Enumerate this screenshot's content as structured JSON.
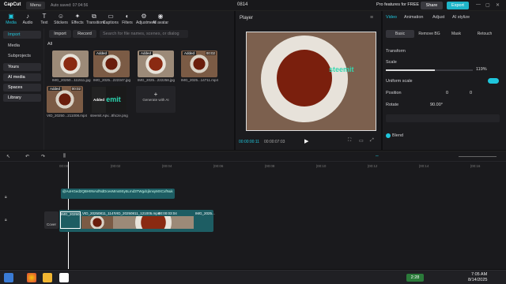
{
  "app": {
    "name": "CapCut",
    "menu": "Menu",
    "autosave": "Auto saved: 07:04:56",
    "project": "0814",
    "pro": "Pro features for FREE",
    "share": "Share",
    "export": "Export"
  },
  "tools": [
    {
      "label": "Media",
      "icon": "▣"
    },
    {
      "label": "Audio",
      "icon": "♪"
    },
    {
      "label": "Text",
      "icon": "T"
    },
    {
      "label": "Stickers",
      "icon": "☺"
    },
    {
      "label": "Effects",
      "icon": "✦"
    },
    {
      "label": "Transitions",
      "icon": "⧉"
    },
    {
      "label": "Captions",
      "icon": "▭"
    },
    {
      "label": "Filters",
      "icon": "◐"
    },
    {
      "label": "Adjustment",
      "icon": "⚙"
    },
    {
      "label": "AI avatar",
      "icon": "◉"
    }
  ],
  "sidenav": {
    "import": "Import",
    "items": [
      "Media",
      "Subprojects",
      "Yours",
      "AI media",
      "Spaces",
      "Library"
    ]
  },
  "media": {
    "import_btn": "Import",
    "record_btn": "Record",
    "search_placeholder": "Search for file names, scenes, or dialog",
    "all": "All",
    "added": "Added",
    "items": [
      {
        "name": "IMG_20250...111511.jpg",
        "tag": "",
        "dur": ""
      },
      {
        "name": "IMG_2025...222347.jpg",
        "tag": "Added",
        "dur": ""
      },
      {
        "name": "IMG_2025...222258.jpg",
        "tag": "Added",
        "dur": ""
      },
      {
        "name": "IMG_2025...14711.mp4",
        "tag": "Added",
        "dur": "00:02"
      },
      {
        "name": "VID_20250...211008.mp4",
        "tag": "Added",
        "dur": "00:02"
      },
      {
        "name": "steemit.Apv...8hcze.png",
        "tag": "Added",
        "dur": ""
      }
    ],
    "generate": "Generate with AI",
    "steemit": "steemit"
  },
  "player": {
    "title": "Player",
    "time_current": "00:00:00:11",
    "time_total": "00:00:07:03"
  },
  "props": {
    "tabs": [
      "Video",
      "Animation",
      "Adjust",
      "AI stylize"
    ],
    "subtabs": [
      "Basic",
      "Remove BG",
      "Mask",
      "Retouch"
    ],
    "transform": "Transform",
    "scale": "Scale",
    "scale_val": "119%",
    "uniform": "Uniform scale",
    "position": "Position",
    "pos_x": "0",
    "pos_y": "0",
    "rotate": "Rotate",
    "rotate_val": "90.00°",
    "blend": "Blend"
  },
  "timeline": {
    "ticks": [
      "00:00",
      "|00:02",
      "|00:04",
      "|00:06",
      "|00:08",
      "|00:10",
      "|00:12",
      "|00:14",
      "|00:16"
    ],
    "text_clip": "@AoHGed2QBH9NAsfNdDcevMms9Sy5Lmd3TWgdcjknsyMXCxfNuk",
    "clips": [
      "IMG_20250...",
      "VID_20250811_1147",
      "VID_20250811_121005.mp4",
      "00:00:03:04",
      "IMG_2025..."
    ],
    "cover": "Cover"
  },
  "taskbar": {
    "clock": "7:05 AM",
    "date": "8/14/2025",
    "temp": "2:28"
  }
}
